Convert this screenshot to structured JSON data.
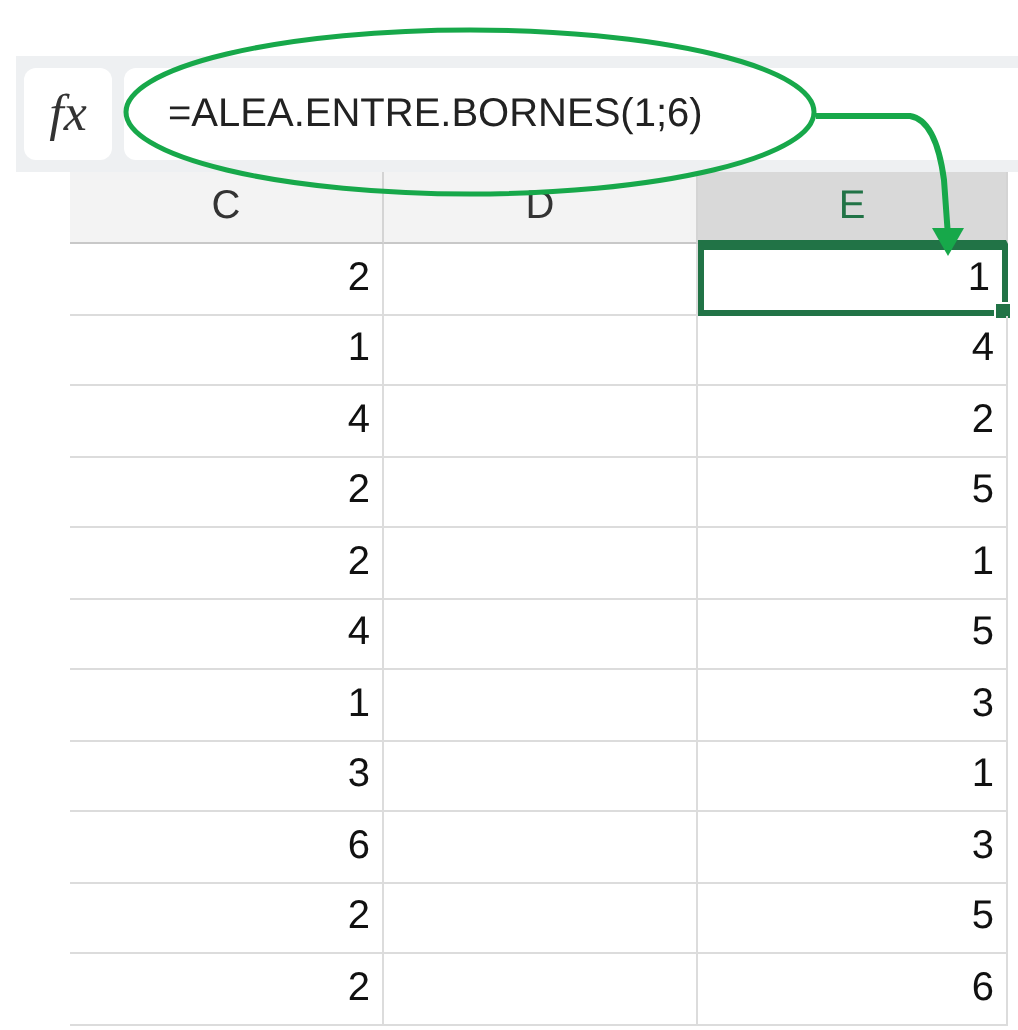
{
  "formula_bar": {
    "function_label": "fx",
    "formula": "=ALEA.ENTRE.BORNES(1;6)"
  },
  "columns": [
    {
      "label": "C",
      "selected": false
    },
    {
      "label": "D",
      "selected": false
    },
    {
      "label": "E",
      "selected": true
    }
  ],
  "rows": [
    {
      "c": "2",
      "e": "1",
      "selected": true
    },
    {
      "c": "1",
      "e": "4",
      "selected": false
    },
    {
      "c": "4",
      "e": "2",
      "selected": false
    },
    {
      "c": "2",
      "e": "5",
      "selected": false
    },
    {
      "c": "2",
      "e": "1",
      "selected": false
    },
    {
      "c": "4",
      "e": "5",
      "selected": false
    },
    {
      "c": "1",
      "e": "3",
      "selected": false
    },
    {
      "c": "3",
      "e": "1",
      "selected": false
    },
    {
      "c": "6",
      "e": "3",
      "selected": false
    },
    {
      "c": "2",
      "e": "5",
      "selected": false
    },
    {
      "c": "2",
      "e": "6",
      "selected": false
    }
  ]
}
